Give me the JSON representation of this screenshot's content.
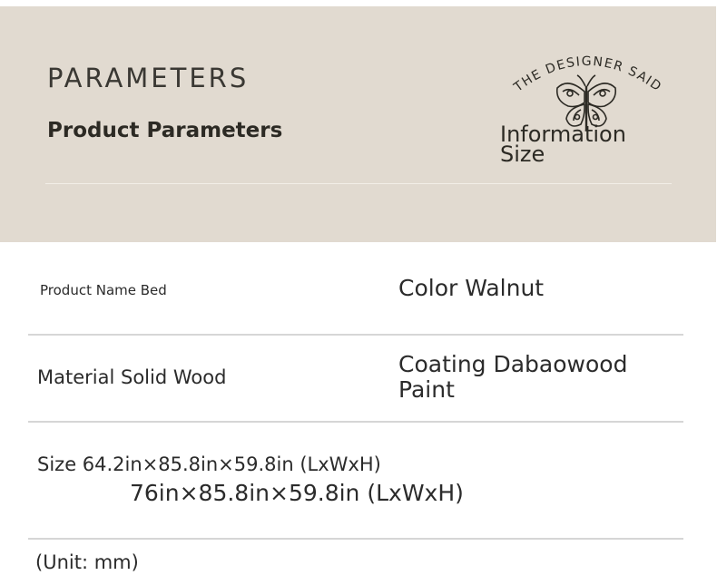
{
  "header": {
    "heading": "PARAMETERS",
    "subheading": "Product Parameters",
    "logo_text": "THE DESIGNER SAID",
    "info_line1": "Information",
    "info_line2": "Size"
  },
  "rows": {
    "product_name": "Product Name Bed",
    "color": "Color Walnut",
    "material": "Material Solid Wood",
    "coating_line1": "Coating Dabaowood",
    "coating_line2": "Paint",
    "size_line1": "Size 64.2in×85.8in×59.8in (LxWxH)",
    "size_line2": "76in×85.8in×59.8in (LxWxH)",
    "unit": "(Unit: mm)"
  },
  "colors": {
    "header_bg": "#e1dad0",
    "text": "#2b2b2b",
    "rule": "#d6d6d6"
  },
  "icons": [
    "butterfly-icon"
  ]
}
